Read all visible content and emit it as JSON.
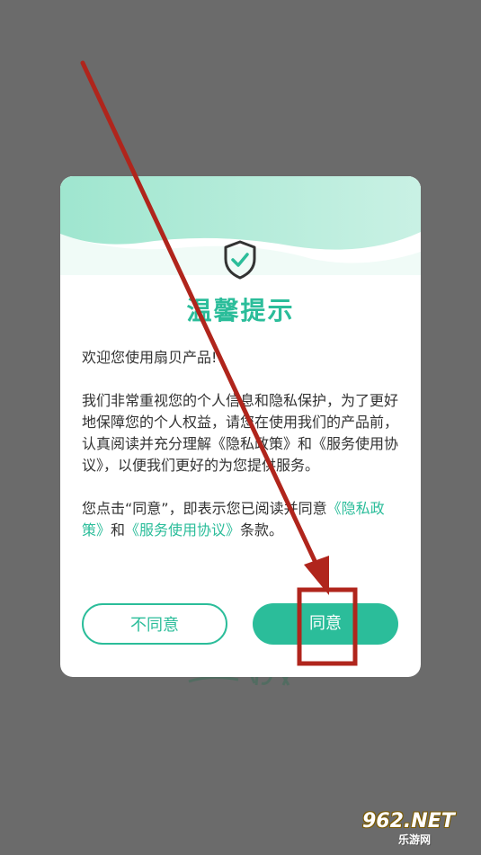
{
  "dialog": {
    "title": "温馨提示",
    "welcome": "欢迎您使用扇贝产品!",
    "main_paragraph": "我们非常重视您的个人信息和隐私保护，为了更好地保障您的个人权益，请您在使用我们的产品前，认真阅读并充分理解《隐私政策》和《服务使用协议》，以便我们更好的为您提供服务。",
    "consent_prefix": "您点击“同意”，即表示您已阅读并同意",
    "privacy_link": "《隐私政策》",
    "consent_and": "和",
    "terms_link": "《服务使用协议》",
    "consent_suffix": "条款。",
    "disagree_label": "不同意",
    "agree_label": "同意",
    "icon": "shield-check-icon"
  },
  "watermark": {
    "brand": "962.NET",
    "site": "乐游网"
  },
  "colors": {
    "accent": "#2bbd9a",
    "overlay": "#6b6b6b",
    "annotation": "#b0251c"
  }
}
